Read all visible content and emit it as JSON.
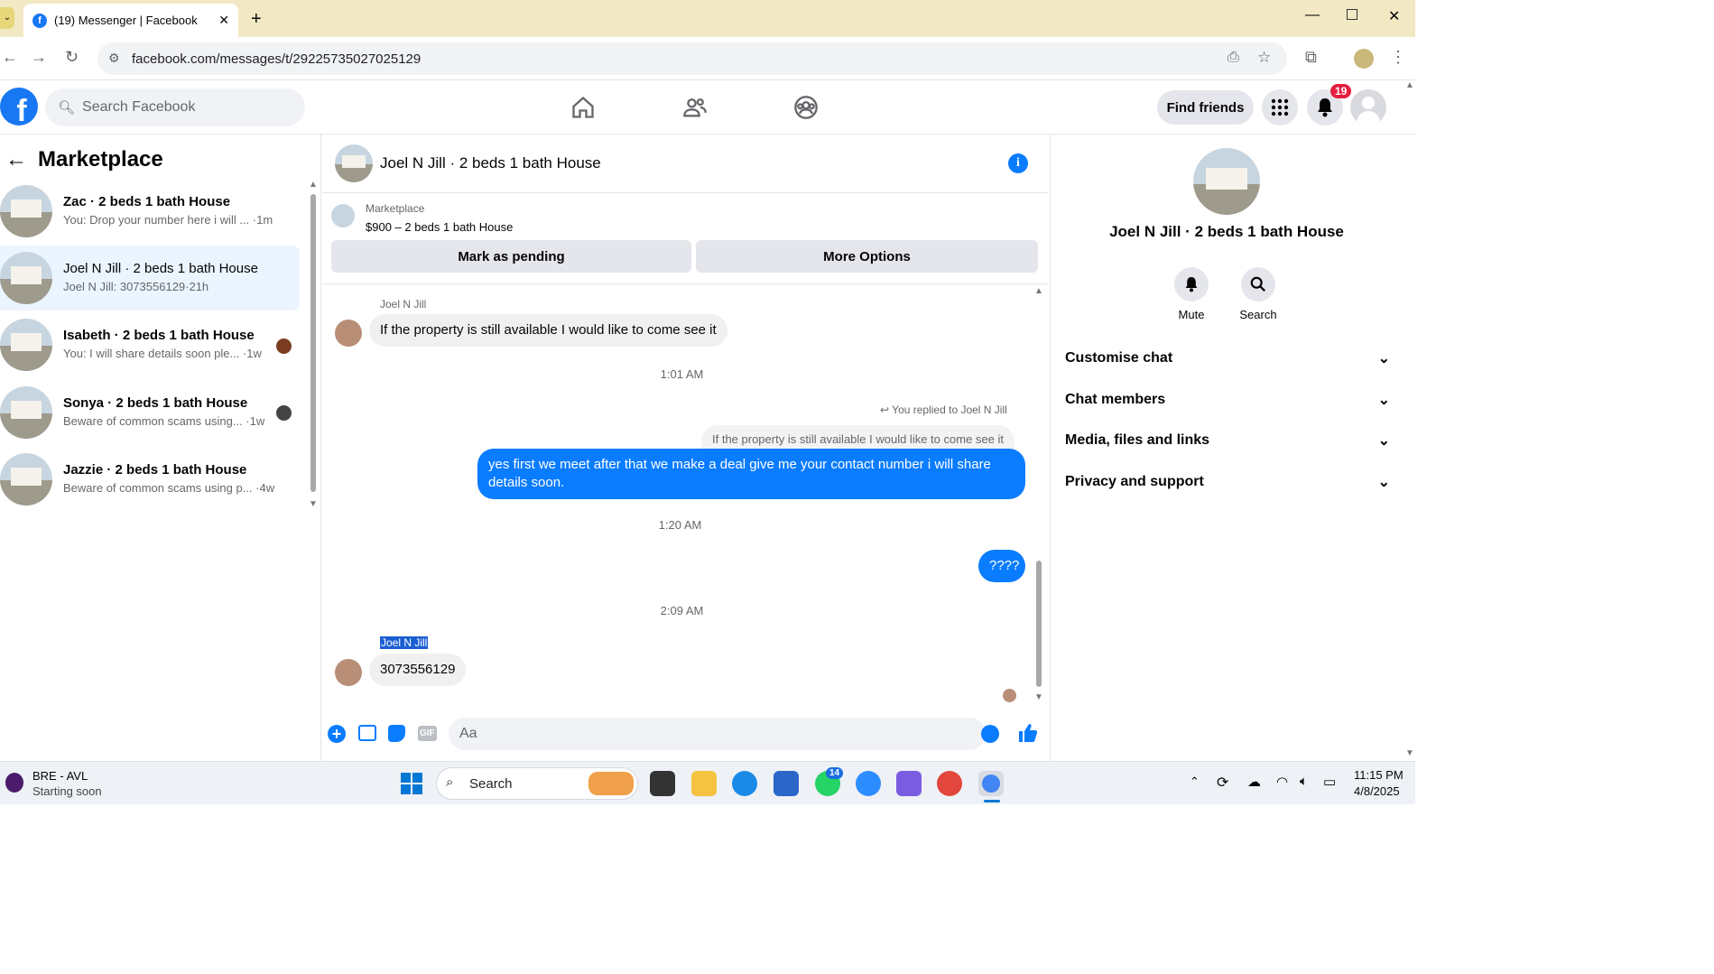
{
  "browser": {
    "tab_title": "(19) Messenger | Facebook",
    "url": "facebook.com/messages/t/29225735027025129"
  },
  "header": {
    "search_placeholder": "Search Facebook",
    "find_friends": "Find friends",
    "notification_count": "19"
  },
  "sidebar": {
    "title": "Marketplace",
    "conversations": [
      {
        "name": "Zac · 2 beds 1 bath House",
        "preview": "You: Drop your number here i will ... ·1m"
      },
      {
        "name": "Joel N Jill · 2 beds 1 bath House",
        "preview": "Joel N Jill: 3073556129·21h"
      },
      {
        "name": "Isabeth · 2 beds 1 bath House",
        "preview": "You: I will share details soon ple... ·1w"
      },
      {
        "name": "Sonya · 2 beds 1 bath House",
        "preview": "Beware of common scams using... ·1w"
      },
      {
        "name": "Jazzie · 2 beds 1 bath House",
        "preview": "Beware of common scams using p... ·4w"
      }
    ]
  },
  "chat": {
    "title": "Joel N Jill · 2 beds 1 bath House",
    "listing_label": "Marketplace",
    "listing_price": "$900 – 2 beds 1 bath House",
    "mark_pending": "Mark as pending",
    "more_options": "More Options",
    "sender1": "Joel N Jill",
    "msg1": "If the property is still available I would like to come see it",
    "time1": "1:01 AM",
    "replied_to": "You replied to Joel N Jill",
    "quoted": "If the property is still available I would like to come see it",
    "msg2": "yes first we meet after that we make a deal give me your contact number i will share details soon.",
    "time2": "1:20 AM",
    "msg3": "????",
    "time3": "2:09 AM",
    "sender2": "Joel N Jill",
    "msg4": "3073556129",
    "composer_placeholder": "Aa"
  },
  "details": {
    "name": "Joel N Jill · 2 beds 1 bath House",
    "mute": "Mute",
    "search": "Search",
    "sections": [
      "Customise chat",
      "Chat members",
      "Media, files and links",
      "Privacy and support"
    ]
  },
  "taskbar": {
    "news_title": "BRE - AVL",
    "news_sub": "Starting soon",
    "search": "Search",
    "whatsapp_badge": "14",
    "time": "11:15 PM",
    "date": "4/8/2025"
  },
  "colors": {
    "brand": "#1877f2",
    "outgoing": "#0a7cff",
    "badge": "#e41e3f"
  }
}
